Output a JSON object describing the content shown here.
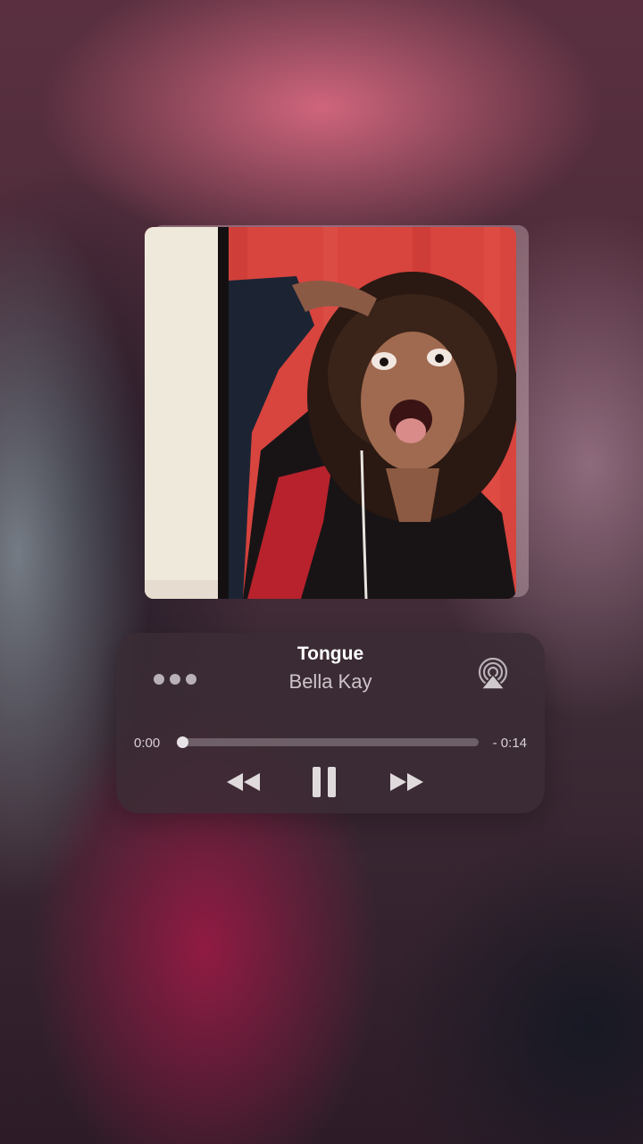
{
  "now_playing": {
    "title": "Tongue",
    "artist": "Bella Kay"
  },
  "progress": {
    "elapsed": "0:00",
    "remaining": "- 0:14",
    "fraction": 0.0
  },
  "controls": {
    "more_icon": "ellipsis-icon",
    "airplay_icon": "airplay-icon",
    "rewind_icon": "rewind-icon",
    "pause_icon": "pause-icon",
    "forward_icon": "fast-forward-icon"
  },
  "colors": {
    "panel": "#3a2c34",
    "controls": "#e0dadd",
    "art_background": "#d8443e"
  }
}
